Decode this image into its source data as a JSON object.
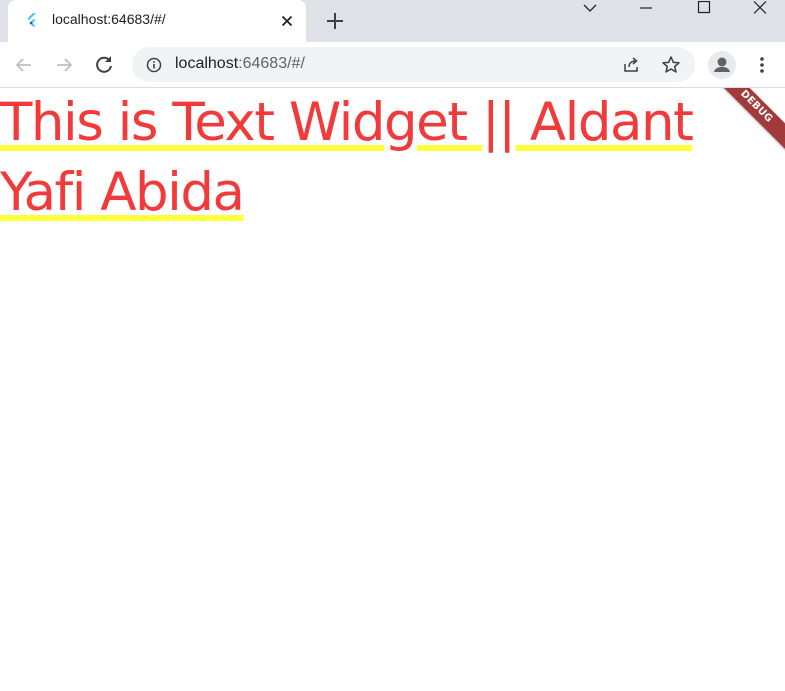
{
  "browser": {
    "tab": {
      "title": "localhost:64683/#/",
      "favicon": "flutter-logo-icon",
      "close_icon": "close-icon"
    },
    "new_tab_icon": "plus-icon",
    "window_controls": [
      "chevron-down-icon",
      "minimize-icon",
      "maximize-icon",
      "close-icon"
    ],
    "toolbar": {
      "back_icon": "arrow-left-icon",
      "forward_icon": "arrow-right-icon",
      "reload_icon": "reload-icon",
      "site_info_icon": "info-icon",
      "url_host": "localhost",
      "url_rest": ":64683/#/",
      "share_icon": "share-icon",
      "bookmark_icon": "star-icon",
      "profile_icon": "profile-avatar-icon",
      "menu_icon": "kebab-menu-icon"
    }
  },
  "app": {
    "text_widget": "This is Text Widget || Aldant Yafi Abida",
    "debug_banner": "DEBUG",
    "colors": {
      "text": "#f23a3a",
      "underline": "#ffff3b",
      "banner": "#a33a3a"
    }
  }
}
